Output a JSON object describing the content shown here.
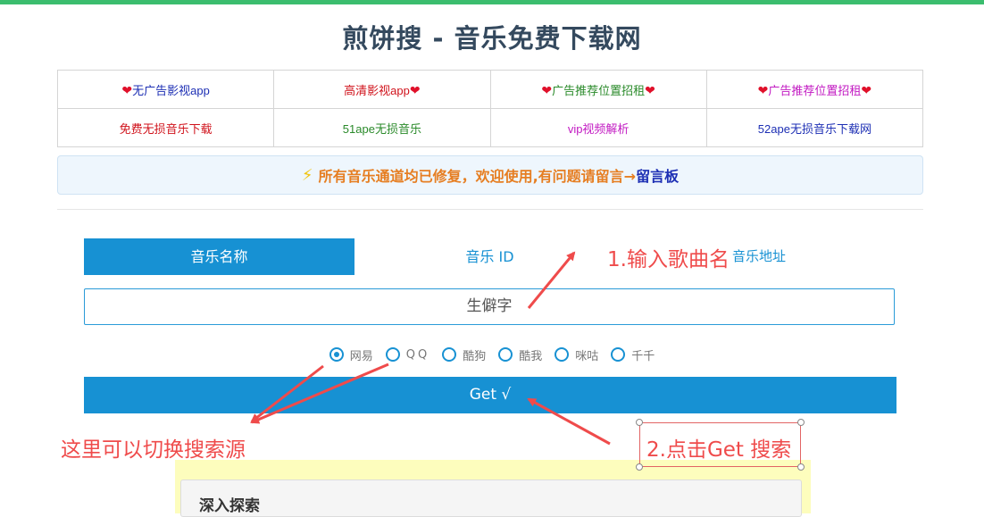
{
  "header": {
    "title": "煎饼搜 - 音乐免费下载网"
  },
  "links": {
    "row1": [
      {
        "label": "无广告影视app",
        "heart_left": true,
        "heart_right": false,
        "color": "#1d2fb4"
      },
      {
        "label": "高清影视app",
        "heart_left": false,
        "heart_right": true,
        "color": "#d0121b"
      },
      {
        "label": "广告推荐位置招租",
        "heart_left": true,
        "heart_right": true,
        "color": "#2a8a2a"
      },
      {
        "label": "广告推荐位置招租",
        "heart_left": true,
        "heart_right": true,
        "color": "#c21ac2"
      }
    ],
    "row2": [
      {
        "label": "免费无损音乐下载",
        "color": "#d0121b"
      },
      {
        "label": "51ape无损音乐",
        "color": "#2a8a2a"
      },
      {
        "label": "vip视频解析",
        "color": "#c21ac2"
      },
      {
        "label": "52ape无损音乐下载网",
        "color": "#1d2fb4"
      }
    ],
    "heart_glyph": "❤"
  },
  "notice": {
    "icon": "⚡",
    "text": "所有音乐通道均已修复，欢迎使用,有问题请留言→",
    "link": "留言板"
  },
  "tabs": {
    "name": "音乐名称",
    "id": "音乐 ID",
    "url": "音乐地址",
    "active": "name"
  },
  "search": {
    "value": "生僻字"
  },
  "sources": {
    "selected": "网易",
    "options": [
      "网易",
      "QQ",
      "酷狗",
      "酷我",
      "咪咕",
      "千千"
    ]
  },
  "get_button": {
    "label": "Get √"
  },
  "deep_search": {
    "title": "深入探索"
  },
  "annotations": {
    "step1": "1.输入歌曲名",
    "switch_source": "这里可以切换搜索源",
    "step2": "2.点击Get 搜索",
    "color": "#ef4b4b"
  }
}
